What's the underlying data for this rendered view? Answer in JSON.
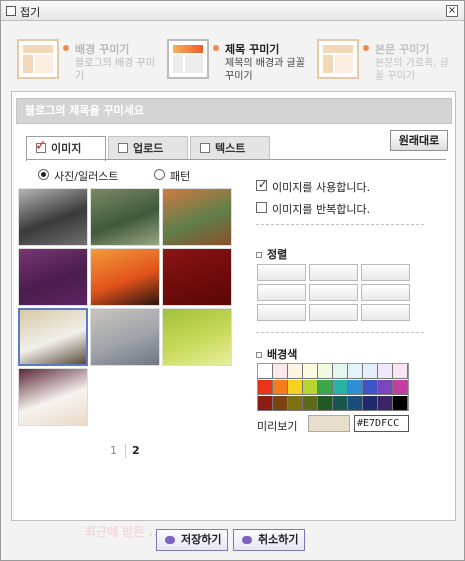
{
  "window": {
    "title": "접기"
  },
  "modes": [
    {
      "title": "배경 꾸미기",
      "desc": "블로그의 배경 꾸미기"
    },
    {
      "title": "제목 꾸미기",
      "desc": "제목의 배경과 글꼴 꾸미기"
    },
    {
      "title": "본문 꾸미기",
      "desc": "본문의 가로폭, 글꼴 꾸미기"
    }
  ],
  "panel": {
    "title": "블로그의 제목을 꾸미세요"
  },
  "tabs": [
    {
      "label": "이미지",
      "active": true
    },
    {
      "label": "업로드",
      "active": false
    },
    {
      "label": "텍스트",
      "active": false
    }
  ],
  "reset_label": "원래대로",
  "radios": [
    {
      "label": "사진/일러스트",
      "selected": true
    },
    {
      "label": "패턴",
      "selected": false
    }
  ],
  "thumbnails": [
    {
      "name": "bw-landscape",
      "colors": [
        "#3a3a3a",
        "#b5b5b5",
        "#6f6f6f"
      ]
    },
    {
      "name": "garden-path",
      "colors": [
        "#3f5a3b",
        "#7a8a67",
        "#9aa682"
      ]
    },
    {
      "name": "wooden-bench",
      "colors": [
        "#5f7f4a",
        "#d07a42",
        "#8a4f2a"
      ]
    },
    {
      "name": "purple-bubbles",
      "colors": [
        "#4a1d4d",
        "#7a3574",
        "#5d2460"
      ]
    },
    {
      "name": "sunset-lamps",
      "colors": [
        "#e2531c",
        "#f39b3a",
        "#2b1510"
      ]
    },
    {
      "name": "red-world-map",
      "colors": [
        "#6f0b0b",
        "#8c1414",
        "#5a0707"
      ]
    },
    {
      "name": "coffee-flowers",
      "colors": [
        "#f1efe9",
        "#d8c9a6",
        "#5a4a3a"
      ]
    },
    {
      "name": "old-street",
      "colors": [
        "#9fa4aa",
        "#c8c5bc",
        "#6e7680"
      ]
    },
    {
      "name": "rainbow-green",
      "colors": [
        "#c9d95a",
        "#a0c23a",
        "#e9f0a0"
      ]
    },
    {
      "name": "cheesecake",
      "colors": [
        "#f7f3f0",
        "#5a2636",
        "#e8d9c5"
      ]
    }
  ],
  "pagination": {
    "pages": [
      "1",
      "2"
    ],
    "current": "2"
  },
  "options": [
    {
      "label": "이미지를 사용합니다.",
      "checked": true
    },
    {
      "label": "이미지를 반복합니다.",
      "checked": false
    }
  ],
  "align_section": {
    "label": "정렬"
  },
  "color_section": {
    "label": "배경색"
  },
  "palette": [
    [
      "#ffffff",
      "#fde9e9",
      "#fff4e2",
      "#fffbe2",
      "#f1fbe2",
      "#e3f7ec",
      "#e3f5f9",
      "#e7eefb",
      "#efe8fb",
      "#f8e6f4"
    ],
    [
      "#e8331d",
      "#f47b1b",
      "#f6d31d",
      "#b7d630",
      "#3aa84a",
      "#29b3a4",
      "#2f8fd6",
      "#3b55c8",
      "#7a46bc",
      "#c23ea0"
    ],
    [
      "#8a1d10",
      "#7a4210",
      "#7c7010",
      "#5d6a1a",
      "#1e5a26",
      "#17574f",
      "#1c4d7a",
      "#1f2a6e",
      "#3d2466",
      "#000000"
    ]
  ],
  "preview": {
    "label": "미리보기",
    "color": "#E7DFCC"
  },
  "buttons": {
    "save": "저장하기",
    "cancel": "취소하기"
  },
  "ghost_text": "최근에 받은 ..."
}
